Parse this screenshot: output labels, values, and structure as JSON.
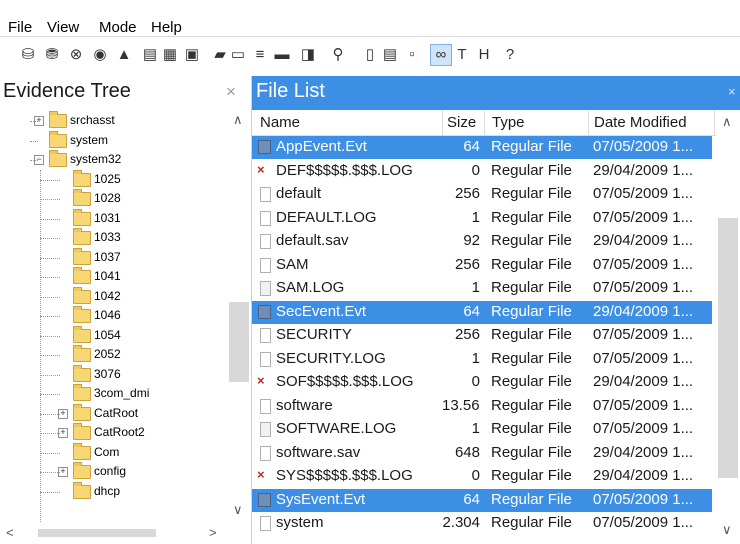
{
  "menu": {
    "file": "File",
    "view": "View",
    "mode": "Mode",
    "help": "Help"
  },
  "toolbar": {
    "icons": [
      "add-evidence-icon",
      "add-image-icon",
      "remove-evidence-icon",
      "view-icon",
      "hat-icon",
      "device-icon",
      "save-icon",
      "image-icon",
      "folder-open-icon",
      "print-icon",
      "hash-icon",
      "ruler-icon",
      "export-icon",
      "key-icon",
      "page-icon",
      "document-icon",
      "blank-page-icon",
      "auto-view-icon",
      "text-view-icon",
      "hex-view-icon",
      "help-icon"
    ]
  },
  "evidence_tree": {
    "title": "Evidence Tree",
    "close": "×",
    "items": [
      {
        "label": "srchasst",
        "level": 1,
        "expander": "+"
      },
      {
        "label": "system",
        "level": 1,
        "expander": ""
      },
      {
        "label": "system32",
        "level": 1,
        "expander": "−"
      },
      {
        "label": "1025",
        "level": 2,
        "expander": ""
      },
      {
        "label": "1028",
        "level": 2,
        "expander": ""
      },
      {
        "label": "1031",
        "level": 2,
        "expander": ""
      },
      {
        "label": "1033",
        "level": 2,
        "expander": ""
      },
      {
        "label": "1037",
        "level": 2,
        "expander": ""
      },
      {
        "label": "1041",
        "level": 2,
        "expander": ""
      },
      {
        "label": "1042",
        "level": 2,
        "expander": ""
      },
      {
        "label": "1046",
        "level": 2,
        "expander": ""
      },
      {
        "label": "1054",
        "level": 2,
        "expander": ""
      },
      {
        "label": "2052",
        "level": 2,
        "expander": ""
      },
      {
        "label": "3076",
        "level": 2,
        "expander": ""
      },
      {
        "label": "3com_dmi",
        "level": 2,
        "expander": ""
      },
      {
        "label": "CatRoot",
        "level": 2,
        "expander": "+"
      },
      {
        "label": "CatRoot2",
        "level": 2,
        "expander": "+"
      },
      {
        "label": "Com",
        "level": 2,
        "expander": ""
      },
      {
        "label": "config",
        "level": 2,
        "expander": "+"
      },
      {
        "label": "dhcp",
        "level": 2,
        "expander": ""
      }
    ]
  },
  "file_list": {
    "title": "File List",
    "close": "×",
    "columns": {
      "name": "Name",
      "size": "Size",
      "type": "Type",
      "date": "Date Modified"
    },
    "rows": [
      {
        "name": "AppEvent.Evt",
        "size": "64",
        "type": "Regular File",
        "date": "07/05/2009 1...",
        "icon": "evt",
        "selected": true
      },
      {
        "name": "DEF$$$$$.$$$.LOG",
        "size": "0",
        "type": "Regular File",
        "date": "29/04/2009 1...",
        "icon": "del",
        "selected": false
      },
      {
        "name": "default",
        "size": "256",
        "type": "Regular File",
        "date": "07/05/2009 1...",
        "icon": "doc",
        "selected": false
      },
      {
        "name": "DEFAULT.LOG",
        "size": "1",
        "type": "Regular File",
        "date": "07/05/2009 1...",
        "icon": "doc",
        "selected": false
      },
      {
        "name": "default.sav",
        "size": "92",
        "type": "Regular File",
        "date": "29/04/2009 1...",
        "icon": "doc",
        "selected": false
      },
      {
        "name": "SAM",
        "size": "256",
        "type": "Regular File",
        "date": "07/05/2009 1...",
        "icon": "doc",
        "selected": false
      },
      {
        "name": "SAM.LOG",
        "size": "1",
        "type": "Regular File",
        "date": "07/05/2009 1...",
        "icon": "log",
        "selected": false
      },
      {
        "name": "SecEvent.Evt",
        "size": "64",
        "type": "Regular File",
        "date": "29/04/2009 1...",
        "icon": "evt",
        "selected": true
      },
      {
        "name": "SECURITY",
        "size": "256",
        "type": "Regular File",
        "date": "07/05/2009 1...",
        "icon": "doc",
        "selected": false
      },
      {
        "name": "SECURITY.LOG",
        "size": "1",
        "type": "Regular File",
        "date": "07/05/2009 1...",
        "icon": "doc",
        "selected": false
      },
      {
        "name": "SOF$$$$$.$$$.LOG",
        "size": "0",
        "type": "Regular File",
        "date": "29/04/2009 1...",
        "icon": "del",
        "selected": false
      },
      {
        "name": "software",
        "size": "13.568",
        "type": "Regular File",
        "date": "07/05/2009 1...",
        "icon": "doc",
        "selected": false
      },
      {
        "name": "SOFTWARE.LOG",
        "size": "1",
        "type": "Regular File",
        "date": "07/05/2009 1...",
        "icon": "log",
        "selected": false
      },
      {
        "name": "software.sav",
        "size": "648",
        "type": "Regular File",
        "date": "29/04/2009 1...",
        "icon": "doc",
        "selected": false
      },
      {
        "name": "SYS$$$$$.$$$.LOG",
        "size": "0",
        "type": "Regular File",
        "date": "29/04/2009 1...",
        "icon": "del",
        "selected": false
      },
      {
        "name": "SysEvent.Evt",
        "size": "64",
        "type": "Regular File",
        "date": "07/05/2009 1...",
        "icon": "evt",
        "selected": true
      },
      {
        "name": "system",
        "size": "2.304",
        "type": "Regular File",
        "date": "07/05/2009 1...",
        "icon": "doc",
        "selected": false
      }
    ]
  },
  "colors": {
    "selection": "#3d8fe6",
    "header_active": "#3d8fe6",
    "folder": "#f7d774",
    "deleted": "#c0281f"
  }
}
